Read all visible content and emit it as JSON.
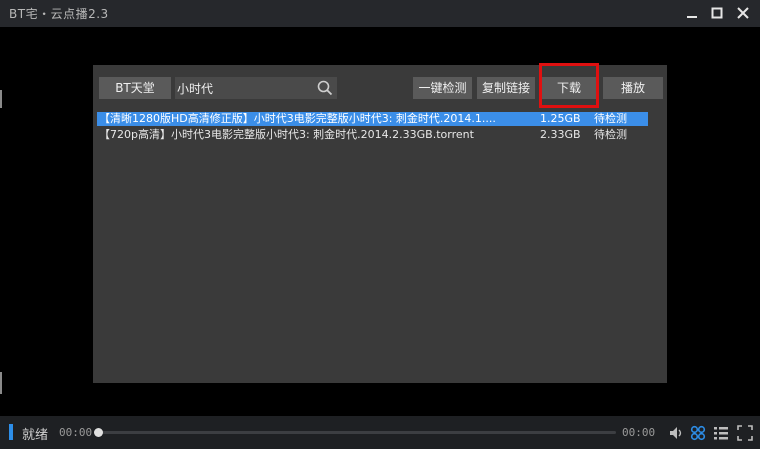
{
  "window": {
    "title": "BT宅・云点播2.3"
  },
  "toolbar": {
    "bt_heaven": "BT天堂",
    "search_value": "小时代",
    "check_all": "一键检测",
    "copy_link": "复制链接",
    "download": "下载",
    "play": "播放"
  },
  "files": [
    {
      "name": "【清晰1280版HD高清修正版】小时代3电影完整版小时代3: 刺金时代.2014.1....",
      "size": "1.25GB",
      "status": "待检测",
      "selected": true
    },
    {
      "name": "【720p高清】小时代3电影完整版小时代3: 刺金时代.2014.2.33GB.torrent",
      "size": "2.33GB",
      "status": "待检测",
      "selected": false
    }
  ],
  "player": {
    "status": "就绪",
    "time_current": "00:00",
    "time_total": "00:00",
    "progress": 0
  },
  "colors": {
    "accent": "#2d8ee8",
    "highlight": "#e01010",
    "selection": "#3b8ee8"
  }
}
